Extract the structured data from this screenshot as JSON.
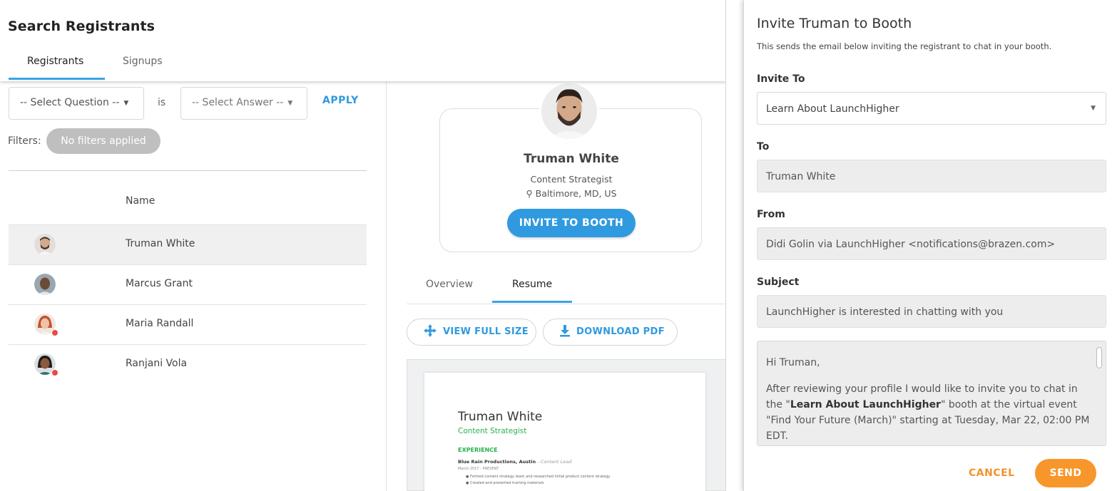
{
  "left_panel": {
    "title": "Search Registrants",
    "tabs": [
      {
        "label": "Registrants",
        "active": true
      },
      {
        "label": "Signups",
        "active": false
      }
    ],
    "filters": {
      "question_placeholder": "-- Select Question --",
      "operator": "is",
      "answer_placeholder": "-- Select Answer --",
      "apply_label": "APPLY",
      "filters_label": "Filters:",
      "chip_text": "No filters applied"
    },
    "list": {
      "name_header": "Name",
      "rows": [
        {
          "name": "Truman White",
          "selected": true,
          "status": "none"
        },
        {
          "name": "Marcus Grant",
          "selected": false,
          "status": "none"
        },
        {
          "name": "Maria Randall",
          "selected": false,
          "status": "busy"
        },
        {
          "name": "Ranjani Vola",
          "selected": false,
          "status": "busy"
        }
      ]
    }
  },
  "profile": {
    "name": "Truman White",
    "title": "Content Strategist",
    "location": "Baltimore, MD, US",
    "invite_button": "INVITE TO BOOTH",
    "tabs": [
      {
        "label": "Overview",
        "active": false
      },
      {
        "label": "Resume",
        "active": true
      }
    ],
    "view_full_size_label": "VIEW FULL SIZE",
    "download_pdf_label": "DOWNLOAD PDF",
    "resume": {
      "name": "Truman White",
      "role": "Content Strategist",
      "section": "EXPERIENCE",
      "job_company": "Blue Rain Productions, Austin",
      "job_role": "- Content Lead",
      "job_dates": "March 2017 - PRESENT",
      "bullets": [
        "Formed content strategy team and researched initial product content strategy",
        "Created and presented training materials"
      ]
    }
  },
  "dialog": {
    "title": "Invite Truman to Booth",
    "subtitle": "This sends the email below inviting the registrant to chat in your booth.",
    "invite_to_label": "Invite To",
    "invite_to_value": "Learn About LaunchHigher",
    "to_label": "To",
    "to_value": "Truman White",
    "from_label": "From",
    "from_value": "Didi Golin via LaunchHigher <notifications@brazen.com>",
    "subject_label": "Subject",
    "subject_value": "LaunchHigher is interested in chatting with you",
    "message_greeting": "Hi Truman,",
    "message_before": "After reviewing your profile I would like to invite you to chat in the \"",
    "message_bold": "Learn About LaunchHigher",
    "message_after": "\" booth at the virtual event \"Find Your Future (March)\" starting at Tuesday, Mar 22, 02:00 PM EDT.",
    "cancel_label": "CANCEL",
    "send_label": "SEND"
  },
  "colors": {
    "accent_blue": "#2f9ae0",
    "accent_orange": "#f7962a",
    "status_busy": "#e84a4a"
  },
  "icons": [
    "chevron-down-icon",
    "location-pin-icon",
    "expand-arrows-icon",
    "download-icon",
    "scrollbar"
  ]
}
